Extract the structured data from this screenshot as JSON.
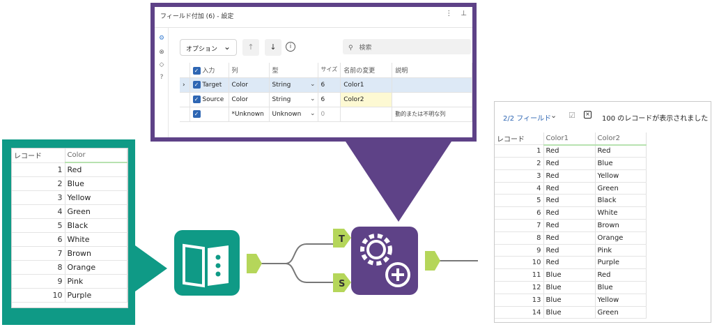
{
  "config": {
    "title": "フィールド付加 (6) - 設定",
    "options_label": "オプション",
    "search_placeholder": "検索",
    "columns": [
      "入力",
      "列",
      "型",
      "サイズ",
      "名前の変更",
      "説明"
    ],
    "rows": [
      {
        "input": "Target",
        "column": "Color",
        "type": "String",
        "size": "6",
        "rename": "Color1",
        "desc": ""
      },
      {
        "input": "Source",
        "column": "Color",
        "type": "String",
        "size": "6",
        "rename": "Color2",
        "desc": ""
      },
      {
        "input": "",
        "column": "*Unknown",
        "type": "Unknown",
        "size": "0",
        "rename": "",
        "desc": "動的または不明な列"
      }
    ]
  },
  "input_table": {
    "header_record": "レコード",
    "header_col": "Color",
    "rows": [
      {
        "n": "1",
        "color": "Red"
      },
      {
        "n": "2",
        "color": "Blue"
      },
      {
        "n": "3",
        "color": "Yellow"
      },
      {
        "n": "4",
        "color": "Green"
      },
      {
        "n": "5",
        "color": "Black"
      },
      {
        "n": "6",
        "color": "White"
      },
      {
        "n": "7",
        "color": "Brown"
      },
      {
        "n": "8",
        "color": "Orange"
      },
      {
        "n": "9",
        "color": "Pink"
      },
      {
        "n": "10",
        "color": "Purple"
      }
    ]
  },
  "output_table": {
    "fields_label": "2/2 フィールド",
    "message": "100 のレコードが表示されました",
    "header_record": "レコード",
    "header_col1": "Color1",
    "header_col2": "Color2",
    "rows": [
      {
        "n": "1",
        "c1": "Red",
        "c2": "Red"
      },
      {
        "n": "2",
        "c1": "Red",
        "c2": "Blue"
      },
      {
        "n": "3",
        "c1": "Red",
        "c2": "Yellow"
      },
      {
        "n": "4",
        "c1": "Red",
        "c2": "Green"
      },
      {
        "n": "5",
        "c1": "Red",
        "c2": "Black"
      },
      {
        "n": "6",
        "c1": "Red",
        "c2": "White"
      },
      {
        "n": "7",
        "c1": "Red",
        "c2": "Brown"
      },
      {
        "n": "8",
        "c1": "Red",
        "c2": "Orange"
      },
      {
        "n": "9",
        "c1": "Red",
        "c2": "Pink"
      },
      {
        "n": "10",
        "c1": "Red",
        "c2": "Purple"
      },
      {
        "n": "11",
        "c1": "Blue",
        "c2": "Red"
      },
      {
        "n": "12",
        "c1": "Blue",
        "c2": "Blue"
      },
      {
        "n": "13",
        "c1": "Blue",
        "c2": "Yellow"
      },
      {
        "n": "14",
        "c1": "Blue",
        "c2": "Green"
      }
    ]
  },
  "workflow": {
    "anchor_t": "T",
    "anchor_s": "S"
  },
  "colors": {
    "teal": "#0f9a86",
    "purple": "#5e4287",
    "anchor_green": "#b5d65a",
    "checkbox_blue": "#2e66b3"
  }
}
